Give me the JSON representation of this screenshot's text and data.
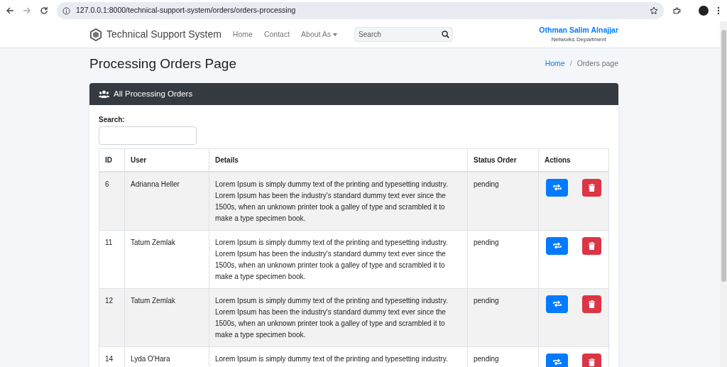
{
  "browser": {
    "url": "127.0.0.1:8000/technical-support-system/orders/orders-processing"
  },
  "navbar": {
    "brand": "Technical Support System",
    "links": [
      {
        "label": "Home",
        "kind": "link"
      },
      {
        "label": "Contact",
        "kind": "link"
      },
      {
        "label": "About As",
        "kind": "dropdown"
      }
    ],
    "search": {
      "placeholder": "Search"
    },
    "user": {
      "name": "Othman Salim Alnajjar",
      "department": "Networks Department"
    }
  },
  "page": {
    "title": "Processing Orders Page",
    "breadcrumb_separator": "/",
    "breadcrumb": [
      {
        "label": "Home",
        "selected": false
      },
      {
        "label": "Orders page",
        "selected": true
      }
    ]
  },
  "card": {
    "title": "All Processing Orders",
    "search_label": "Search:",
    "table": {
      "columns": [
        "ID",
        "User",
        "Details",
        "Status Order",
        "Actions"
      ],
      "rows": [
        {
          "id": "6",
          "user": "Adrianna Heller",
          "details": "Lorem Ipsum is simply dummy text of the printing and typesetting industry. Lorem Ipsum has been the industry's standard dummy text ever since the 1500s, when an unknown printer took a galley of type and scrambled it to make a type specimen book.",
          "status": "pending"
        },
        {
          "id": "11",
          "user": "Tatum Zemlak",
          "details": "Lorem Ipsum is simply dummy text of the printing and typesetting industry. Lorem Ipsum has been the industry's standard dummy text ever since the 1500s, when an unknown printer took a galley of type and scrambled it to make a type specimen book.",
          "status": "pending"
        },
        {
          "id": "12",
          "user": "Tatum Zemlak",
          "details": "Lorem Ipsum is simply dummy text of the printing and typesetting industry. Lorem Ipsum has been the industry's standard dummy text ever since the 1500s, when an unknown printer took a galley of type and scrambled it to make a type specimen book.",
          "status": "pending"
        },
        {
          "id": "14",
          "user": "Lyda O'Hara",
          "details": "Lorem Ipsum is simply dummy text of the printing and typesetting industry.",
          "status": "pending"
        }
      ]
    }
  }
}
